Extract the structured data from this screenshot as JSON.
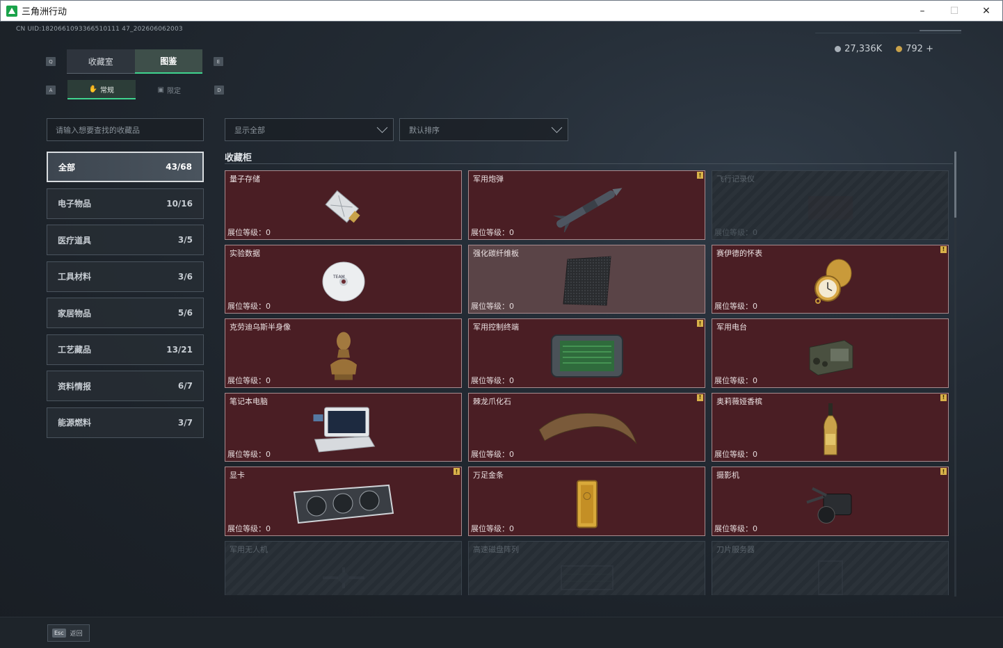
{
  "window": {
    "title": "三角洲行动",
    "controls": [
      "–",
      "☐",
      "✕"
    ]
  },
  "uid": "CN UID:1820661093366510111 47_202606062003",
  "currency": {
    "silver": "27,336K",
    "gold": "792",
    "add": "+"
  },
  "keys": {
    "q": "Q",
    "e": "E",
    "a": "A",
    "d": "D"
  },
  "tabs_main": [
    {
      "label": "收藏室"
    },
    {
      "label": "图鉴"
    }
  ],
  "tabs_sub": [
    {
      "label": "常规"
    },
    {
      "label": "限定"
    }
  ],
  "search": {
    "placeholder": "请输入想要查找的收藏品"
  },
  "filters": {
    "show": "显示全部",
    "sort": "默认排序"
  },
  "categories": [
    {
      "label": "全部",
      "count": "43/68"
    },
    {
      "label": "电子物品",
      "count": "10/16"
    },
    {
      "label": "医疗道具",
      "count": "3/5"
    },
    {
      "label": "工具材料",
      "count": "3/6"
    },
    {
      "label": "家居物品",
      "count": "5/6"
    },
    {
      "label": "工艺藏品",
      "count": "13/21"
    },
    {
      "label": "资料情报",
      "count": "6/7"
    },
    {
      "label": "能源燃料",
      "count": "3/7"
    }
  ],
  "section_title": "收藏柜",
  "level_label": "展位等级：",
  "items": [
    {
      "name": "量子存储",
      "level": "0",
      "badge": "",
      "style": "red",
      "icon": "usb-drive-icon"
    },
    {
      "name": "军用炮弹",
      "level": "0",
      "badge": "!",
      "style": "red",
      "icon": "missile-icon"
    },
    {
      "name": "飞行记录仪",
      "level": "0",
      "badge": "",
      "style": "locked",
      "icon": "flight-recorder-icon"
    },
    {
      "name": "实验数据",
      "level": "0",
      "badge": "",
      "style": "red",
      "icon": "cd-disc-icon"
    },
    {
      "name": "强化碳纤维板",
      "level": "0",
      "badge": "",
      "style": "grey",
      "icon": "carbon-plate-icon"
    },
    {
      "name": "赛伊德的怀表",
      "level": "0",
      "badge": "!",
      "style": "red",
      "icon": "pocket-watch-icon"
    },
    {
      "name": "克劳迪乌斯半身像",
      "level": "0",
      "badge": "",
      "style": "red",
      "icon": "bust-statue-icon"
    },
    {
      "name": "军用控制终端",
      "level": "0",
      "badge": "!",
      "style": "red",
      "icon": "control-terminal-icon"
    },
    {
      "name": "军用电台",
      "level": "0",
      "badge": "",
      "style": "red",
      "icon": "radio-icon"
    },
    {
      "name": "笔记本电脑",
      "level": "0",
      "badge": "",
      "style": "red",
      "icon": "laptop-icon"
    },
    {
      "name": "棘龙爪化石",
      "level": "0",
      "badge": "!",
      "style": "red",
      "icon": "claw-fossil-icon"
    },
    {
      "name": "奥莉薇娅香槟",
      "level": "0",
      "badge": "!",
      "style": "red",
      "icon": "champagne-bottle-icon"
    },
    {
      "name": "显卡",
      "level": "0",
      "badge": "!",
      "style": "red",
      "icon": "graphics-card-icon"
    },
    {
      "name": "万足金条",
      "level": "0",
      "badge": "",
      "style": "red",
      "icon": "gold-bar-icon"
    },
    {
      "name": "摄影机",
      "level": "0",
      "badge": "!",
      "style": "red",
      "icon": "video-camera-icon"
    },
    {
      "name": "军用无人机",
      "level": "",
      "badge": "",
      "style": "locked",
      "icon": "drone-icon"
    },
    {
      "name": "高速磁盘阵列",
      "level": "",
      "badge": "",
      "style": "locked",
      "icon": "disk-array-icon"
    },
    {
      "name": "刀片服务器",
      "level": "",
      "badge": "",
      "style": "locked",
      "icon": "blade-server-icon"
    }
  ],
  "footer": {
    "esc_key": "Esc",
    "esc_label": "返回"
  }
}
